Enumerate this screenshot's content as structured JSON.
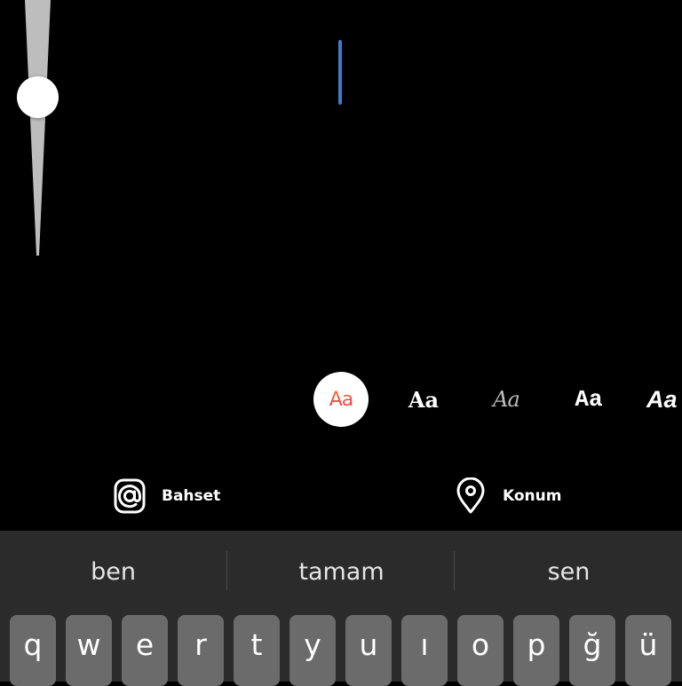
{
  "text_editor": {
    "cursor_color": "#3b7bd0",
    "size_slider": {
      "value_fraction": 0.2
    }
  },
  "font_styles": [
    {
      "label": "Aa",
      "style": "modern",
      "selected": true
    },
    {
      "label": "Aa",
      "style": "classic",
      "selected": false
    },
    {
      "label": "Aa",
      "style": "script",
      "selected": false
    },
    {
      "label": "Aa",
      "style": "typewriter",
      "selected": false
    },
    {
      "label": "Aa",
      "style": "strong",
      "selected": false
    }
  ],
  "actions": {
    "mention": {
      "label": "Bahset",
      "icon": "at-sign-icon"
    },
    "location": {
      "label": "Konum",
      "icon": "location-pin-icon"
    }
  },
  "keyboard": {
    "suggestions": [
      "ben",
      "tamam",
      "sen"
    ],
    "top_row": [
      "q",
      "w",
      "e",
      "r",
      "t",
      "y",
      "u",
      "ı",
      "o",
      "p",
      "ğ",
      "ü"
    ]
  }
}
